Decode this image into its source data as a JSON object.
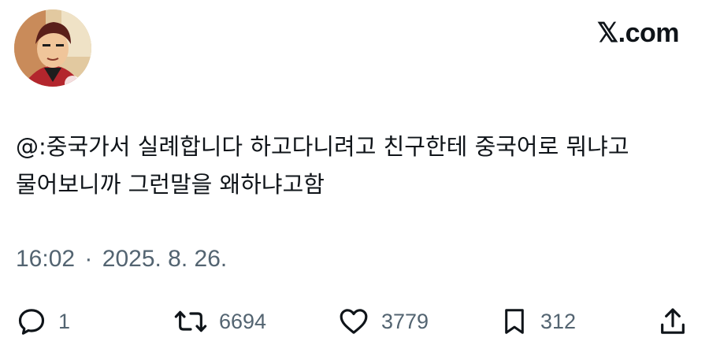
{
  "header": {
    "brand": "𝕏.com",
    "avatar_icon": "profile-avatar"
  },
  "tweet": {
    "text": "@:중국가서 실례합니다 하고다니려고 친구한테 중국어로 뭐냐고 물어보니까 그런말을 왜하냐고함",
    "time": "16:02",
    "separator": "·",
    "date": "2025. 8. 26."
  },
  "actions": {
    "reply": {
      "icon": "reply-icon",
      "count": "1"
    },
    "retweet": {
      "icon": "retweet-icon",
      "count": "6694"
    },
    "like": {
      "icon": "heart-icon",
      "count": "3779"
    },
    "bookmark": {
      "icon": "bookmark-icon",
      "count": "312"
    },
    "share": {
      "icon": "share-icon"
    }
  },
  "colors": {
    "text": "#0f1419",
    "muted": "#536471",
    "background": "#ffffff"
  }
}
